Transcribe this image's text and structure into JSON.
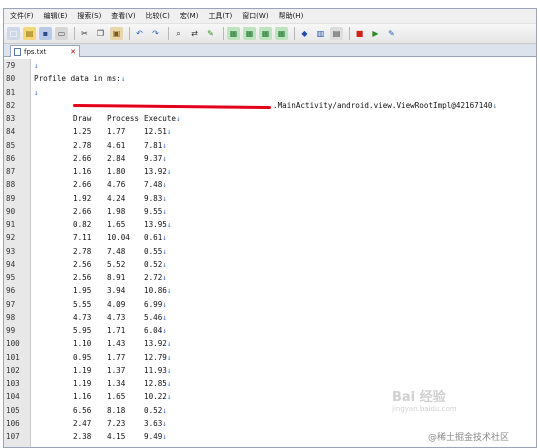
{
  "menu": [
    "文件(F)",
    "编辑(E)",
    "搜索(S)",
    "查看(V)",
    "比较(C)",
    "宏(M)",
    "工具(T)",
    "窗口(W)",
    "帮助(H)"
  ],
  "toolbar": {
    "icons": [
      {
        "name": "new-file-icon",
        "glyph": "□",
        "color": "#ffffff",
        "bg": "#cfd8e6"
      },
      {
        "name": "open-folder-icon",
        "glyph": "▤",
        "color": "#8a6d00",
        "bg": "#f3d77a"
      },
      {
        "name": "save-icon",
        "glyph": "▪",
        "color": "#2a4c8a",
        "bg": "#b9c9e6"
      },
      {
        "name": "print-icon",
        "glyph": "▭",
        "color": "#444444",
        "bg": "#d8d8d8"
      },
      {
        "name": "cut-icon",
        "glyph": "✂",
        "color": "#333333",
        "bg": "transparent"
      },
      {
        "name": "copy-icon",
        "glyph": "❐",
        "color": "#333333",
        "bg": "transparent"
      },
      {
        "name": "paste-icon",
        "glyph": "▣",
        "color": "#7a5b13",
        "bg": "#e8d7a8"
      },
      {
        "name": "undo-icon",
        "glyph": "↶",
        "color": "#2560c2",
        "bg": "transparent"
      },
      {
        "name": "redo-icon",
        "glyph": "↷",
        "color": "#2560c2",
        "bg": "transparent"
      },
      {
        "name": "find-icon",
        "glyph": "⌕",
        "color": "#333333",
        "bg": "transparent"
      },
      {
        "name": "replace-icon",
        "glyph": "⇄",
        "color": "#333333",
        "bg": "transparent"
      },
      {
        "name": "highlight-icon",
        "glyph": "✎",
        "color": "#3a8a1e",
        "bg": "transparent"
      },
      {
        "name": "sync-scroll-icon",
        "glyph": "▦",
        "color": "#1c7a32",
        "bg": "#bfe3bf"
      },
      {
        "name": "word-wrap-icon",
        "glyph": "▦",
        "color": "#1c7a32",
        "bg": "#bfe3bf"
      },
      {
        "name": "column-mode-icon",
        "glyph": "▦",
        "color": "#1c7a32",
        "bg": "#bfe3bf"
      },
      {
        "name": "hex-view-icon",
        "glyph": "▦",
        "color": "#1c7a32",
        "bg": "#bfe3bf"
      },
      {
        "name": "ftp-icon",
        "glyph": "◆",
        "color": "#1f4ea8",
        "bg": "transparent"
      },
      {
        "name": "compare-icon",
        "glyph": "▥",
        "color": "#1f4ea8",
        "bg": "transparent"
      },
      {
        "name": "script-icon",
        "glyph": "▤",
        "color": "#444444",
        "bg": "#dddddd"
      },
      {
        "name": "macro-record-icon",
        "glyph": "■",
        "color": "#d0201a",
        "bg": "transparent"
      },
      {
        "name": "macro-play-icon",
        "glyph": "▶",
        "color": "#2b8a21",
        "bg": "transparent"
      },
      {
        "name": "tools-icon",
        "glyph": "✎",
        "color": "#2560c2",
        "bg": "transparent"
      }
    ]
  },
  "tab": {
    "label": "fps.txt"
  },
  "editor": {
    "eol_marker": "↓",
    "lines": [
      {
        "n": "79",
        "type": "blank"
      },
      {
        "n": "80",
        "type": "text",
        "text": "Profile data in ms:"
      },
      {
        "n": "81",
        "type": "blank"
      },
      {
        "n": "82",
        "type": "redacted",
        "text": ".MainActivity/android.view.ViewRootImpl@42167140"
      },
      {
        "n": "83",
        "type": "header",
        "cols": [
          "Draw",
          "Process",
          "Execute"
        ]
      },
      {
        "n": "84",
        "type": "row",
        "cols": [
          "1.25",
          "1.77",
          "12.51"
        ]
      },
      {
        "n": "85",
        "type": "row",
        "cols": [
          "2.78",
          "4.61",
          "7.81"
        ]
      },
      {
        "n": "86",
        "type": "row",
        "cols": [
          "2.66",
          "2.84",
          "9.37"
        ]
      },
      {
        "n": "87",
        "type": "row",
        "cols": [
          "1.16",
          "1.80",
          "13.92"
        ]
      },
      {
        "n": "88",
        "type": "row",
        "cols": [
          "2.66",
          "4.76",
          "7.48"
        ]
      },
      {
        "n": "89",
        "type": "row",
        "cols": [
          "1.92",
          "4.24",
          "9.83"
        ]
      },
      {
        "n": "90",
        "type": "row",
        "cols": [
          "2.66",
          "1.98",
          "9.55"
        ]
      },
      {
        "n": "91",
        "type": "row",
        "cols": [
          "0.82",
          "1.65",
          "13.95"
        ]
      },
      {
        "n": "92",
        "type": "row",
        "cols": [
          "7.11",
          "10.04",
          "0.61"
        ]
      },
      {
        "n": "93",
        "type": "row",
        "cols": [
          "2.78",
          "7.48",
          "0.55"
        ]
      },
      {
        "n": "94",
        "type": "row",
        "cols": [
          "2.56",
          "5.52",
          "0.52"
        ]
      },
      {
        "n": "95",
        "type": "row",
        "cols": [
          "2.56",
          "8.91",
          "2.72"
        ]
      },
      {
        "n": "96",
        "type": "row",
        "cols": [
          "1.95",
          "3.94",
          "10.86"
        ]
      },
      {
        "n": "97",
        "type": "row",
        "cols": [
          "5.55",
          "4.09",
          "6.99"
        ]
      },
      {
        "n": "98",
        "type": "row",
        "cols": [
          "4.73",
          "4.73",
          "5.46"
        ]
      },
      {
        "n": "99",
        "type": "row",
        "cols": [
          "5.95",
          "1.71",
          "6.04"
        ]
      },
      {
        "n": "100",
        "type": "row",
        "cols": [
          "1.10",
          "1.43",
          "13.92"
        ]
      },
      {
        "n": "101",
        "type": "row",
        "cols": [
          "0.95",
          "1.77",
          "12.79"
        ]
      },
      {
        "n": "102",
        "type": "row",
        "cols": [
          "1.19",
          "1.37",
          "11.93"
        ]
      },
      {
        "n": "103",
        "type": "row",
        "cols": [
          "1.19",
          "1.34",
          "12.85"
        ]
      },
      {
        "n": "104",
        "type": "row",
        "cols": [
          "1.16",
          "1.65",
          "10.22"
        ]
      },
      {
        "n": "105",
        "type": "row",
        "cols": [
          "6.56",
          "8.18",
          "0.52"
        ]
      },
      {
        "n": "106",
        "type": "row",
        "cols": [
          "2.47",
          "7.23",
          "3.63"
        ]
      },
      {
        "n": "107",
        "type": "row",
        "cols": [
          "2.38",
          "4.15",
          "9.49"
        ]
      }
    ]
  },
  "watermark": {
    "brand": "Bai 经验",
    "sub": "jingyan.baidu.com"
  },
  "credit": "@稀土掘金技术社区"
}
